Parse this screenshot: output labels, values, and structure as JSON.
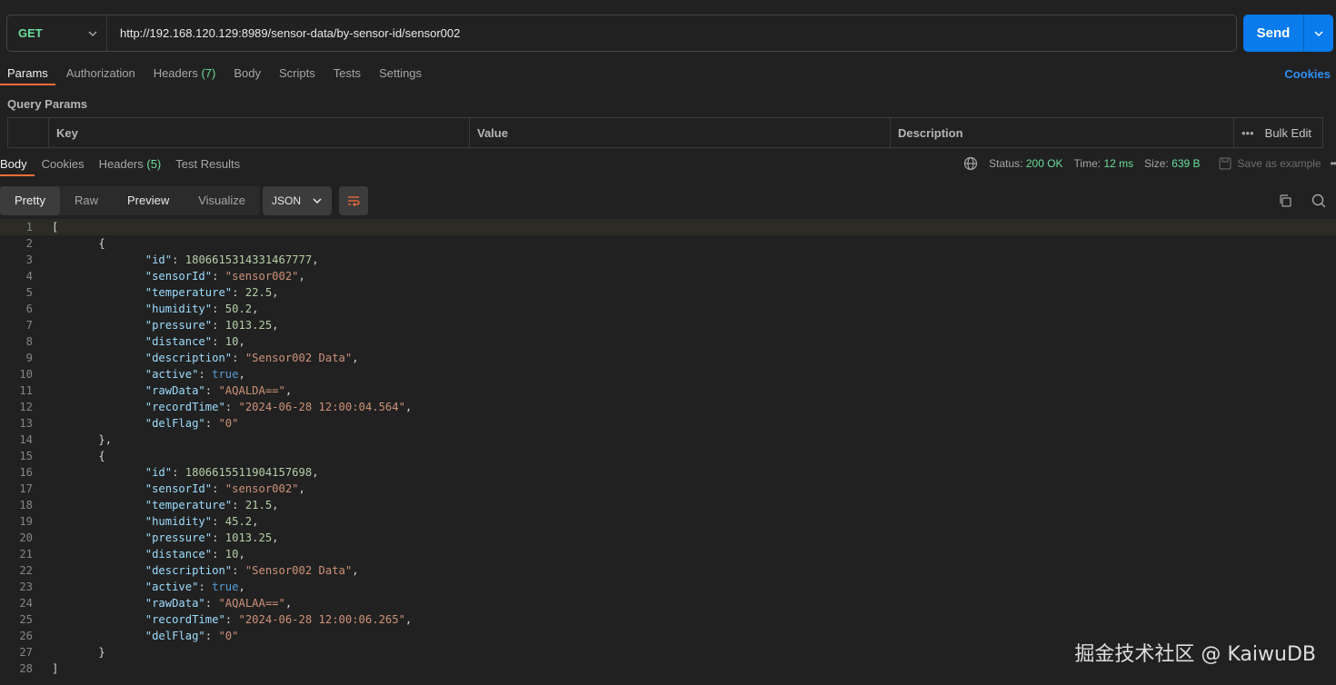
{
  "request": {
    "method": "GET",
    "url": "http://192.168.120.129:8989/sensor-data/by-sensor-id/sensor002",
    "send_label": "Send"
  },
  "request_tabs": [
    {
      "label": "Params",
      "active": true
    },
    {
      "label": "Authorization"
    },
    {
      "label": "Headers",
      "count": "(7)"
    },
    {
      "label": "Body"
    },
    {
      "label": "Scripts"
    },
    {
      "label": "Tests"
    },
    {
      "label": "Settings"
    }
  ],
  "cookies_link": "Cookies",
  "query_params": {
    "title": "Query Params",
    "columns": [
      "Key",
      "Value",
      "Description"
    ],
    "bulk_edit": "Bulk Edit"
  },
  "response_tabs": [
    {
      "label": "Body",
      "active": true
    },
    {
      "label": "Cookies"
    },
    {
      "label": "Headers",
      "count": "(5)"
    },
    {
      "label": "Test Results"
    }
  ],
  "status": {
    "status_label": "Status:",
    "status_value": "200 OK",
    "time_label": "Time:",
    "time_value": "12 ms",
    "size_label": "Size:",
    "size_value": "639 B",
    "save_label": "Save as example"
  },
  "format": {
    "modes": [
      "Pretty",
      "Raw",
      "Preview",
      "Visualize"
    ],
    "active": "Pretty",
    "language": "JSON"
  },
  "response_body": [
    {
      "id": "1806615314331467777",
      "sensorId": "sensor002",
      "temperature": "22.5",
      "humidity": "50.2",
      "pressure": "1013.25",
      "distance": "10",
      "description": "Sensor002 Data",
      "active": "true",
      "rawData": "AQALDA==",
      "recordTime": "2024-06-28 12:00:04.564",
      "delFlag": "0"
    },
    {
      "id": "1806615511904157698",
      "sensorId": "sensor002",
      "temperature": "21.5",
      "humidity": "45.2",
      "pressure": "1013.25",
      "distance": "10",
      "description": "Sensor002 Data",
      "active": "true",
      "rawData": "AQALAA==",
      "recordTime": "2024-06-28 12:00:06.265",
      "delFlag": "0"
    }
  ],
  "watermark": "掘金技术社区 @ KaiwuDB",
  "colors": {
    "accent": "#097bed",
    "tab_underline": "#ff6c37",
    "method_get": "#6bdd9a",
    "status_ok": "#6bdd9a"
  }
}
